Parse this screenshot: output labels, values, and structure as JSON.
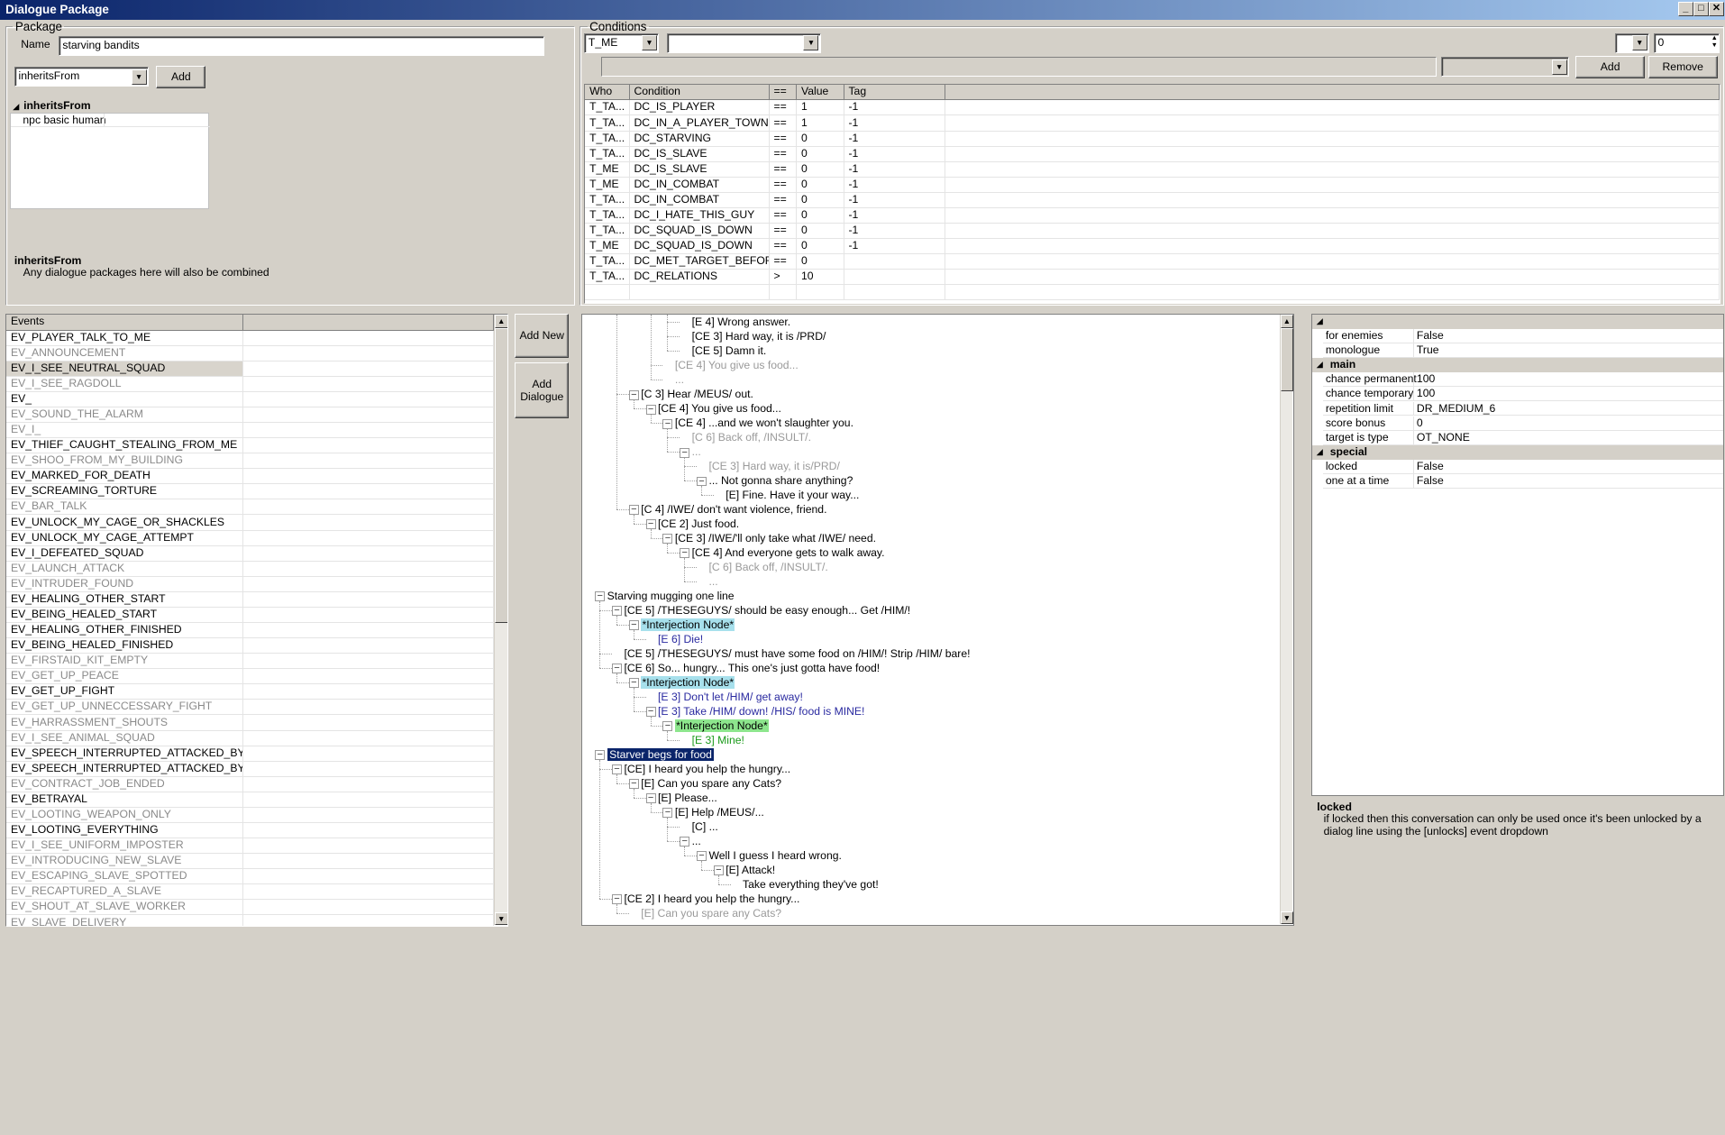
{
  "window": {
    "title": "Dialogue Package",
    "controls": [
      "_",
      "□",
      "✕"
    ]
  },
  "package": {
    "legend": "Package",
    "name_label": "Name",
    "name_value": "starving bandits",
    "combo_value": "inheritsFrom",
    "add_label": "Add",
    "tree_header": "inheritsFrom",
    "tree_item": "npc basic human",
    "help_title": "inheritsFrom",
    "help_text": "Any dialogue packages here will also be combined"
  },
  "conditions": {
    "legend": "Conditions",
    "who_combo": "T_ME",
    "cond_combo": "",
    "num_combo": "",
    "num_value": "0",
    "add_label": "Add",
    "remove_label": "Remove",
    "columns": [
      "Who",
      "Condition",
      "==",
      "Value",
      "Tag"
    ],
    "rows": [
      [
        "T_TA...",
        "DC_IS_PLAYER",
        "==",
        "1",
        "-1"
      ],
      [
        "T_TA...",
        "DC_IN_A_PLAYER_TOWN",
        "==",
        "1",
        "-1"
      ],
      [
        "T_TA...",
        "DC_STARVING",
        "==",
        "0",
        "-1"
      ],
      [
        "T_TA...",
        "DC_IS_SLAVE",
        "==",
        "0",
        "-1"
      ],
      [
        "T_ME",
        "DC_IS_SLAVE",
        "==",
        "0",
        "-1"
      ],
      [
        "T_ME",
        "DC_IN_COMBAT",
        "==",
        "0",
        "-1"
      ],
      [
        "T_TA...",
        "DC_IN_COMBAT",
        "==",
        "0",
        "-1"
      ],
      [
        "T_TA...",
        "DC_I_HATE_THIS_GUY",
        "==",
        "0",
        "-1"
      ],
      [
        "T_TA...",
        "DC_SQUAD_IS_DOWN",
        "==",
        "0",
        "-1"
      ],
      [
        "T_ME",
        "DC_SQUAD_IS_DOWN",
        "==",
        "0",
        "-1"
      ],
      [
        "T_TA...",
        "DC_MET_TARGET_BEFORE",
        "==",
        "0",
        ""
      ],
      [
        "T_TA...",
        "DC_RELATIONS",
        ">",
        "10",
        ""
      ]
    ]
  },
  "events": {
    "header": "Events",
    "selected_index": 2,
    "items": [
      {
        "label": "EV_PLAYER_TALK_TO_ME",
        "active": true
      },
      {
        "label": "EV_ANNOUNCEMENT",
        "active": false
      },
      {
        "label": "EV_I_SEE_NEUTRAL_SQUAD",
        "active": true
      },
      {
        "label": "EV_I_SEE_RAGDOLL",
        "active": false
      },
      {
        "label": "EV_",
        "active": true
      },
      {
        "label": "EV_SOUND_THE_ALARM",
        "active": false
      },
      {
        "label": "EV_I_",
        "active": false
      },
      {
        "label": "EV_THIEF_CAUGHT_STEALING_FROM_ME",
        "active": true
      },
      {
        "label": "EV_SHOO_FROM_MY_BUILDING",
        "active": false
      },
      {
        "label": "EV_MARKED_FOR_DEATH",
        "active": true
      },
      {
        "label": "EV_SCREAMING_TORTURE",
        "active": true
      },
      {
        "label": "EV_BAR_TALK",
        "active": false
      },
      {
        "label": "EV_UNLOCK_MY_CAGE_OR_SHACKLES",
        "active": true
      },
      {
        "label": "EV_UNLOCK_MY_CAGE_ATTEMPT",
        "active": true
      },
      {
        "label": "EV_I_DEFEATED_SQUAD",
        "active": true
      },
      {
        "label": "EV_LAUNCH_ATTACK",
        "active": false
      },
      {
        "label": "EV_INTRUDER_FOUND",
        "active": false
      },
      {
        "label": "EV_HEALING_OTHER_START",
        "active": true
      },
      {
        "label": "EV_BEING_HEALED_START",
        "active": true
      },
      {
        "label": "EV_HEALING_OTHER_FINISHED",
        "active": true
      },
      {
        "label": "EV_BEING_HEALED_FINISHED",
        "active": true
      },
      {
        "label": "EV_FIRSTAID_KIT_EMPTY",
        "active": false
      },
      {
        "label": "EV_GET_UP_PEACE",
        "active": false
      },
      {
        "label": "EV_GET_UP_FIGHT",
        "active": true
      },
      {
        "label": "EV_GET_UP_UNNECCESSARY_FIGHT",
        "active": false
      },
      {
        "label": "EV_HARRASSMENT_SHOUTS",
        "active": false
      },
      {
        "label": "EV_I_SEE_ANIMAL_SQUAD",
        "active": false
      },
      {
        "label": "EV_SPEECH_INTERRUPTED_ATTACKED_BY_T...",
        "active": true
      },
      {
        "label": "EV_SPEECH_INTERRUPTED_ATTACKED_BY_S...",
        "active": true
      },
      {
        "label": "EV_CONTRACT_JOB_ENDED",
        "active": false
      },
      {
        "label": "EV_BETRAYAL",
        "active": true
      },
      {
        "label": "EV_LOOTING_WEAPON_ONLY",
        "active": false
      },
      {
        "label": "EV_LOOTING_EVERYTHING",
        "active": true
      },
      {
        "label": "EV_I_SEE_UNIFORM_IMPOSTER",
        "active": false
      },
      {
        "label": "EV_INTRODUCING_NEW_SLAVE",
        "active": false
      },
      {
        "label": "EV_ESCAPING_SLAVE_SPOTTED",
        "active": false
      },
      {
        "label": "EV_RECAPTURED_A_SLAVE",
        "active": false
      },
      {
        "label": "EV_SHOUT_AT_SLAVE_WORKER",
        "active": false
      },
      {
        "label": "EV_SLAVE_DELIVERY",
        "active": false
      }
    ]
  },
  "actions": {
    "add_new": "Add New",
    "add_dialogue": "Add Dialogue"
  },
  "tree": {
    "nodes": [
      {
        "text": "[E 4] Wrong answer.",
        "d": 5,
        "s": "n",
        "t": ""
      },
      {
        "text": "[CE 3] Hard way, it is /PRD/",
        "d": 5,
        "s": "n",
        "t": ""
      },
      {
        "text": "[CE 5] Damn it.",
        "d": 5,
        "s": "n",
        "t": ""
      },
      {
        "text": "[CE 4] You give us food...",
        "d": 4,
        "s": "g",
        "t": ""
      },
      {
        "text": "...",
        "d": 4,
        "s": "g",
        "t": ""
      },
      {
        "text": "[C 3] Hear /MEUS/ out.",
        "d": 2,
        "s": "n",
        "t": "-"
      },
      {
        "text": "[CE 4] You give us food...",
        "d": 3,
        "s": "n",
        "t": "-"
      },
      {
        "text": "[CE 4] ...and we won't slaughter you.",
        "d": 4,
        "s": "n",
        "t": "-"
      },
      {
        "text": "[C 6] Back off, /INSULT/.",
        "d": 5,
        "s": "g",
        "t": ""
      },
      {
        "text": "...",
        "d": 5,
        "s": "g",
        "t": "-"
      },
      {
        "text": "[CE 3] Hard way, it is/PRD/",
        "d": 6,
        "s": "g",
        "t": ""
      },
      {
        "text": "... Not gonna share anything?",
        "d": 6,
        "s": "n",
        "t": "-"
      },
      {
        "text": "[E] Fine. Have it your way...",
        "d": 7,
        "s": "n",
        "t": ""
      },
      {
        "text": "[C 4] /IWE/ don't want violence, friend.",
        "d": 2,
        "s": "n",
        "t": "-"
      },
      {
        "text": "[CE 2] Just food.",
        "d": 3,
        "s": "n",
        "t": "-"
      },
      {
        "text": "[CE 3] /IWE/'ll only take what /IWE/ need.",
        "d": 4,
        "s": "n",
        "t": "-"
      },
      {
        "text": "[CE 4] And everyone gets to walk away.",
        "d": 5,
        "s": "n",
        "t": "-"
      },
      {
        "text": "[C 6] Back off, /INSULT/.",
        "d": 6,
        "s": "g",
        "t": ""
      },
      {
        "text": "...",
        "d": 6,
        "s": "g",
        "t": ""
      },
      {
        "text": "Starving mugging one line",
        "d": 0,
        "s": "n",
        "t": "-"
      },
      {
        "text": "[CE 5] /THESEGUYS/ should be easy enough... Get /HIM/!",
        "d": 1,
        "s": "n",
        "t": "-"
      },
      {
        "text": "*Interjection Node*",
        "d": 2,
        "s": "hlc",
        "t": "-"
      },
      {
        "text": "[E 6] Die!",
        "d": 3,
        "s": "b",
        "t": ""
      },
      {
        "text": "[CE 5] /THESEGUYS/ must have some food on /HIM/! Strip /HIM/ bare!",
        "d": 1,
        "s": "n",
        "t": ""
      },
      {
        "text": "[CE 6] So... hungry... This one's just gotta have food!",
        "d": 1,
        "s": "n",
        "t": "-"
      },
      {
        "text": "*Interjection Node*",
        "d": 2,
        "s": "hlc",
        "t": "-"
      },
      {
        "text": "[E 3] Don't let /HIM/ get away!",
        "d": 3,
        "s": "b",
        "t": ""
      },
      {
        "text": "[E 3] Take /HIM/ down! /HIS/ food is MINE!",
        "d": 3,
        "s": "b",
        "t": "-"
      },
      {
        "text": "*Interjection Node*",
        "d": 4,
        "s": "hlg",
        "t": "-"
      },
      {
        "text": "[E 3] Mine!",
        "d": 5,
        "s": "gr",
        "t": ""
      },
      {
        "text": "Starver begs for food",
        "d": 0,
        "s": "hld",
        "t": "-"
      },
      {
        "text": "[CE] I heard you help the hungry...",
        "d": 1,
        "s": "n",
        "t": "-"
      },
      {
        "text": "[E] Can you spare any Cats?",
        "d": 2,
        "s": "n",
        "t": "-"
      },
      {
        "text": "[E] Please...",
        "d": 3,
        "s": "n",
        "t": "-"
      },
      {
        "text": "[E] Help /MEUS/...",
        "d": 4,
        "s": "n",
        "t": "-"
      },
      {
        "text": "[C] ...",
        "d": 5,
        "s": "n",
        "t": ""
      },
      {
        "text": "...",
        "d": 5,
        "s": "n",
        "t": "-"
      },
      {
        "text": "Well I guess I heard wrong.",
        "d": 6,
        "s": "n",
        "t": "-"
      },
      {
        "text": "[E] Attack!",
        "d": 7,
        "s": "n",
        "t": "-"
      },
      {
        "text": "Take everything they've got!",
        "d": 8,
        "s": "n",
        "t": ""
      },
      {
        "text": "[CE 2] I heard you help the hungry...",
        "d": 1,
        "s": "n",
        "t": "-"
      },
      {
        "text": "[E] Can you spare any Cats?",
        "d": 2,
        "s": "g",
        "t": ""
      }
    ]
  },
  "properties": {
    "rows": [
      {
        "type": "cat",
        "label": ""
      },
      {
        "type": "row",
        "k": "for enemies",
        "v": "False"
      },
      {
        "type": "row",
        "k": "monologue",
        "v": "True"
      },
      {
        "type": "cat",
        "label": "main"
      },
      {
        "type": "row",
        "k": "chance permanent",
        "v": "100"
      },
      {
        "type": "row",
        "k": "chance temporary",
        "v": "100"
      },
      {
        "type": "row",
        "k": "repetition limit",
        "v": "DR_MEDIUM_6"
      },
      {
        "type": "row",
        "k": "score bonus",
        "v": "0"
      },
      {
        "type": "row",
        "k": "target is type",
        "v": "OT_NONE"
      },
      {
        "type": "cat",
        "label": "special"
      },
      {
        "type": "row",
        "k": "locked",
        "v": "False"
      },
      {
        "type": "row",
        "k": "one at a time",
        "v": "False"
      }
    ],
    "help_title": "locked",
    "help_text": "if locked then this conversation can only be used once it's been unlocked by a dialog line using the [unlocks] event dropdown"
  }
}
